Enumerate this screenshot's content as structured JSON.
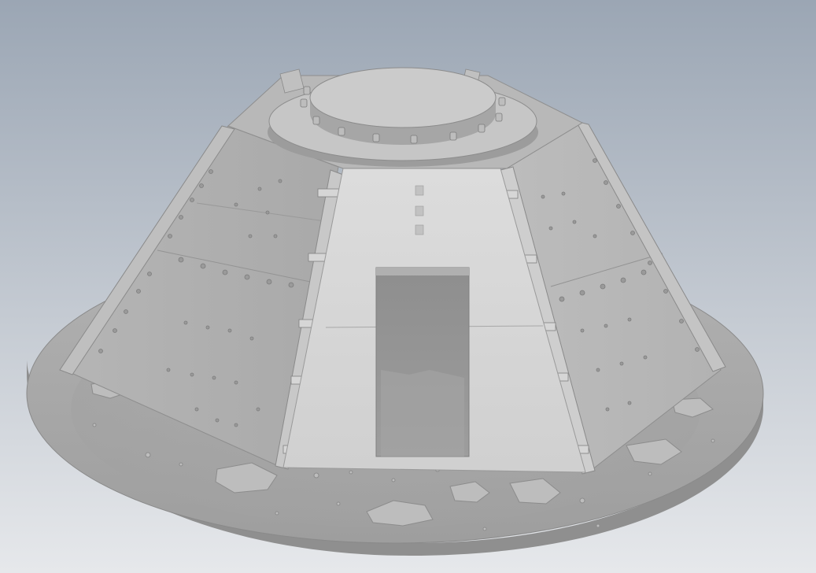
{
  "viewport": {
    "background": {
      "top_color": "#9ba6b4",
      "bottom_color": "#e6e8eb"
    }
  },
  "model": {
    "render_style": "shaded-grey",
    "base_color": "#b9b9b9",
    "features": [
      "base-plate",
      "truncated-pyramid-walls",
      "bolted-panels",
      "rectangular-doorway",
      "bolted-top-flange",
      "rubble"
    ]
  }
}
